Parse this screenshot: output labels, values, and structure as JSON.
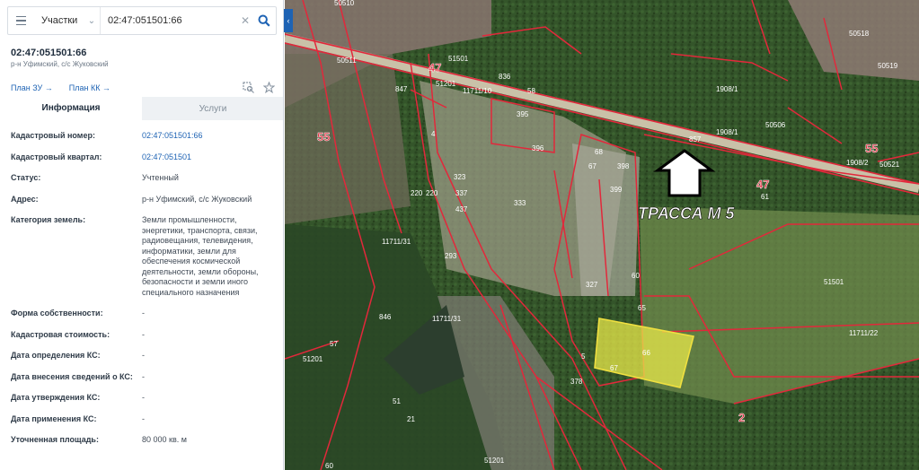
{
  "search": {
    "category": "Участки",
    "query": "02:47:051501:66"
  },
  "object": {
    "title": "02:47:051501:66",
    "subtitle": "р-н Уфимский, с/с Жуковский",
    "plan_zu": "План ЗУ →",
    "plan_kk": "План КК →"
  },
  "tabs": {
    "info": "Информация",
    "services": "Услуги"
  },
  "rows": [
    {
      "label": "Кадастровый номер:",
      "value": "02:47:051501:66",
      "link": true
    },
    {
      "label": "Кадастровый квартал:",
      "value": "02:47:051501",
      "link": true
    },
    {
      "label": "Статус:",
      "value": "Учтенный",
      "link": false
    },
    {
      "label": "Адрес:",
      "value": "р-н Уфимский, с/с Жуковский",
      "link": false
    },
    {
      "label": "Категория земель:",
      "value": "Земли промышленности, энергетики, транспорта, связи, радиовещания, телевидения, информатики, земли для обеспечения космической деятельности, земли обороны, безопасности и земли иного специального назначения",
      "link": false
    },
    {
      "label": "Форма собственности:",
      "value": "-",
      "link": false
    },
    {
      "label": "Кадастровая стоимость:",
      "value": "-",
      "link": false
    },
    {
      "label": "Дата определения КС:",
      "value": "-",
      "link": false
    },
    {
      "label": "Дата внесения сведений о КС:",
      "value": "-",
      "link": false
    },
    {
      "label": "Дата утверждения КС:",
      "value": "-",
      "link": false
    },
    {
      "label": "Дата применения КС:",
      "value": "-",
      "link": false
    },
    {
      "label": "Уточненная площадь:",
      "value": "80 000 кв. м",
      "link": false
    }
  ],
  "map": {
    "annotation": "ТРАССА М 5",
    "labels": [
      "50510",
      "50518",
      "50511",
      "50519",
      "51501",
      "51201",
      "55",
      "55",
      "47",
      "47",
      "2",
      "857",
      "847",
      "836",
      "58",
      "395",
      "1908/1",
      "1908/1",
      "1908/2",
      "50506",
      "50521",
      "11711/10",
      "4",
      "396",
      "68",
      "67",
      "398",
      "399",
      "323",
      "337",
      "333",
      "437",
      "61",
      "220",
      "220",
      "11711/31",
      "11711/31",
      "293",
      "327",
      "60",
      "65",
      "51501",
      "11711/22",
      "846",
      "57",
      "51201",
      "66",
      "67",
      "378",
      "51",
      "21",
      "51201",
      "60",
      "5",
      "1"
    ],
    "colors": {
      "boundary": "#e2283b",
      "selected": "#e8e84a",
      "forest": "#2f4f24"
    }
  },
  "watermark": {
    "text": "Уфимские земли"
  }
}
